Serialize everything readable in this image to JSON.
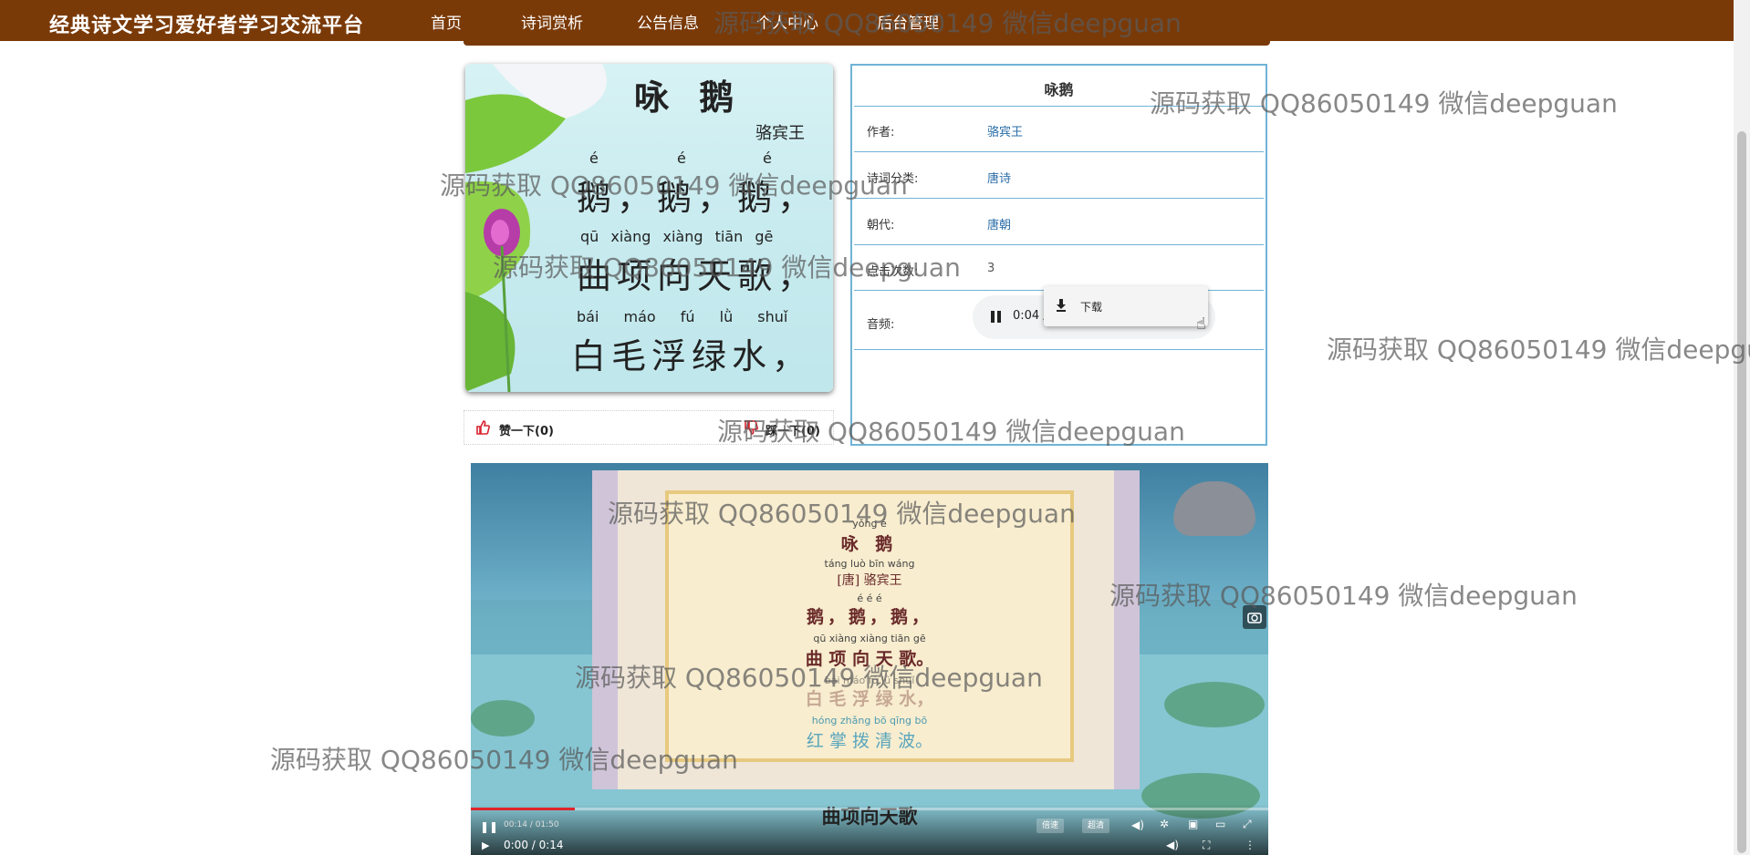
{
  "nav": {
    "brand": "经典诗文学习爱好者学习交流平台",
    "links": [
      "首页",
      "诗词赏析",
      "公告信息",
      "个人中心",
      "后台管理"
    ]
  },
  "poem_image": {
    "title": "咏 鹅",
    "author": "骆宾王",
    "line1_pinyin": [
      "é",
      "é",
      "é"
    ],
    "line1": "鹅，鹅，鹅，",
    "line2_pinyin": "qū xiàng xiàng tiān gē",
    "line2": "曲项向天歌，",
    "line3_pinyin": "bái máo fú lǜ shuǐ",
    "line3": "白毛浮绿水，"
  },
  "info": {
    "title": "咏鹅",
    "rows": [
      {
        "label": "作者:",
        "value": "骆宾王"
      },
      {
        "label": "诗词分类:",
        "value": "唐诗"
      },
      {
        "label": "朝代:",
        "value": "唐朝"
      },
      {
        "label": "点击次数:",
        "value": "3"
      },
      {
        "label": "音频:",
        "value": ""
      }
    ]
  },
  "audio": {
    "time": "0:04 /",
    "menu_item": "下载"
  },
  "likes": {
    "like_label": "赞一下(0)",
    "dislike_label": "踩一下(0)"
  },
  "video": {
    "scroll_title_pinyin": "yǒng é",
    "scroll_title": "咏 鹅",
    "scroll_author_pinyin": "táng luò bīn wáng",
    "scroll_author": "[唐] 骆宾王",
    "l1_pinyin": "é   é   é",
    "l1": "鹅，鹅，鹅，",
    "l2_pinyin": "qū xiàng xiàng tiān gē",
    "l2": "曲 项 向 天 歌。",
    "l3_pinyin": "bái máo fú lǜ shuǐ",
    "l3": "白 毛 浮 绿 水，",
    "l4_pinyin": "hóng zhǎng bō qīng bō",
    "l4": "红 掌 拨 清 波。",
    "subtitle": "曲项向天歌",
    "inner_time": "00:14 / 01:50",
    "player_time": "0:00 / 0:14",
    "progress": 0.13,
    "btn_speed": "倍速",
    "btn_quality": "超清"
  },
  "watermark": "源码获取 QQ86050149 微信deepguan",
  "colors": {
    "nav_bg": "#7a3a08",
    "panel_border": "#6fb3d6",
    "value_link": "#2b6ea8",
    "like_red": "#d9232f"
  }
}
